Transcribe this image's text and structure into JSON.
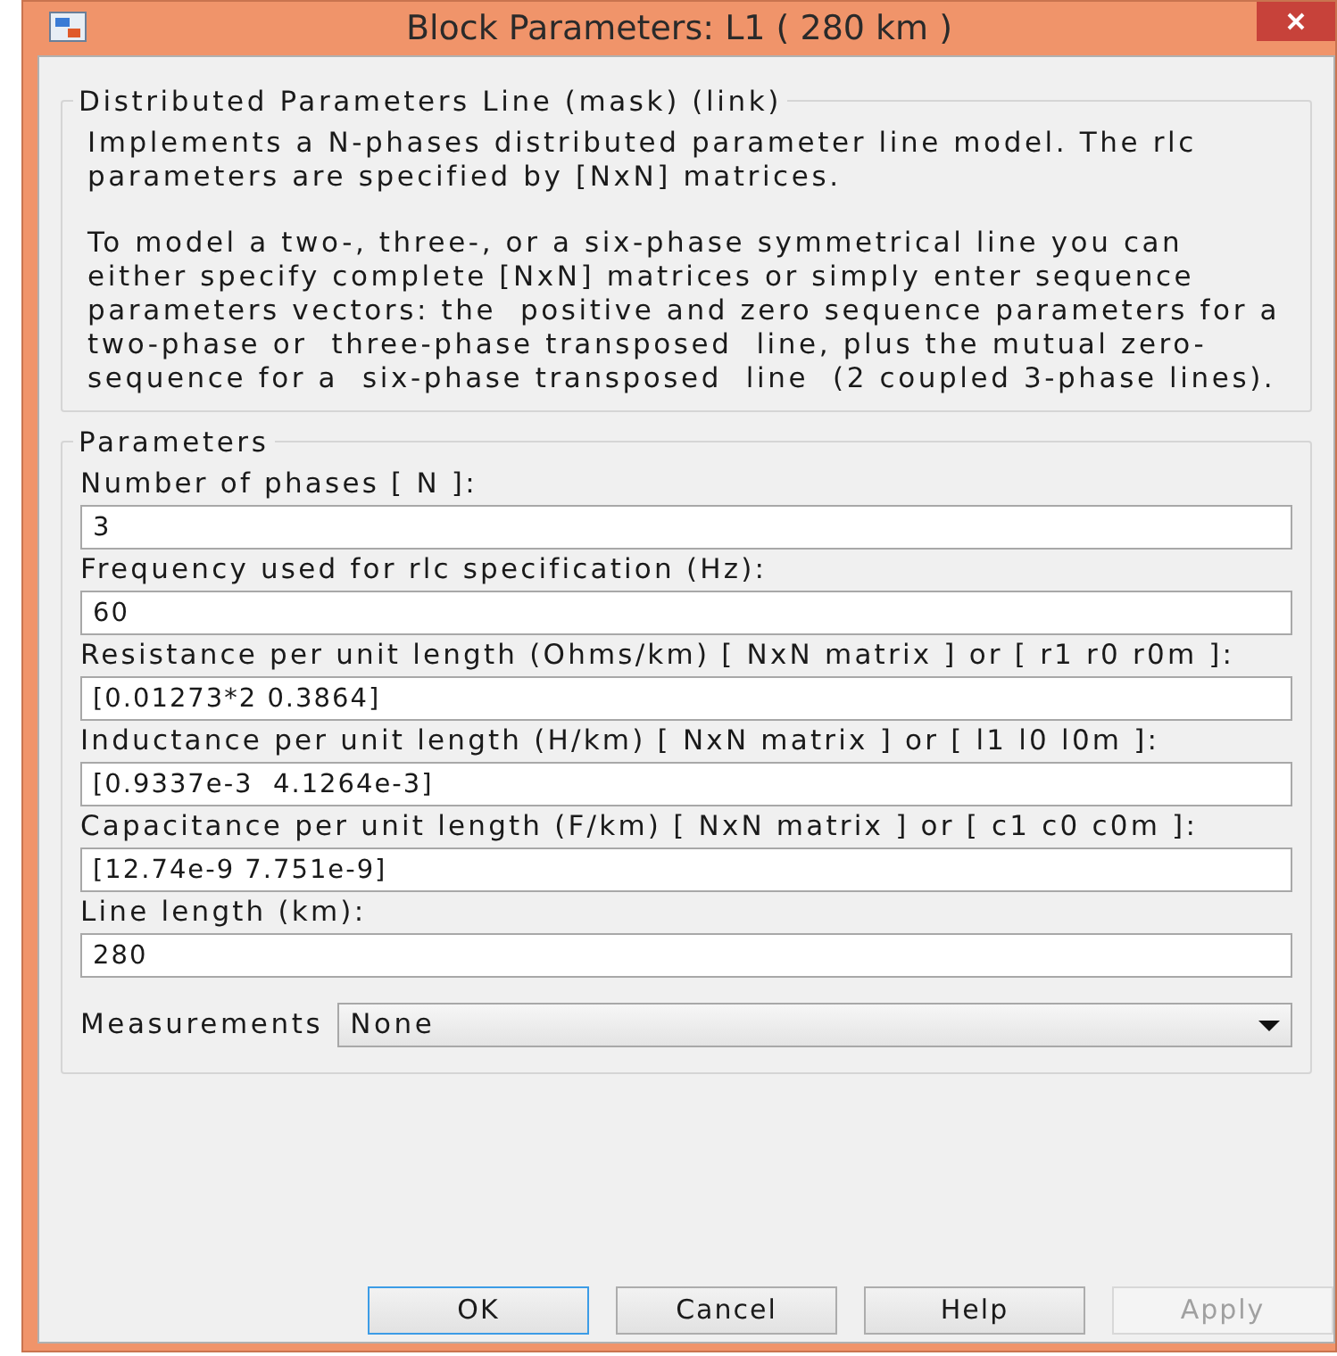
{
  "window": {
    "title": "Block Parameters: L1 ( 280 km )"
  },
  "description": {
    "title": "Distributed Parameters Line (mask) (link)",
    "paragraphs": [
      "Implements a N-phases distributed parameter line model. The rlc\nparameters are specified by [NxN] matrices.",
      "To model a two-, three-, or a six-phase symmetrical line you can\neither specify complete [NxN] matrices or simply enter sequence\nparameters vectors: the  positive and zero sequence parameters for a\ntwo-phase or  three-phase transposed  line, plus the mutual zero-\nsequence for a  six-phase transposed  line  (2 coupled 3-phase lines)."
    ]
  },
  "parameters": {
    "title": "Parameters",
    "fields": [
      {
        "label": "Number of phases [ N ]:",
        "value": "3"
      },
      {
        "label": "Frequency used for rlc specification (Hz):",
        "value": "60"
      },
      {
        "label": "Resistance per unit length (Ohms/km) [ NxN matrix ] or [ r1 r0 r0m ]:",
        "value": "[0.01273*2 0.3864]"
      },
      {
        "label": "Inductance per unit length (H/km) [ NxN matrix ] or [ l1 l0 l0m ]:",
        "value": "[0.9337e-3  4.1264e-3]"
      },
      {
        "label": "Capacitance per unit length (F/km) [ NxN matrix ] or [ c1 c0 c0m ]:",
        "value": "[12.74e-9 7.751e-9]"
      },
      {
        "label": "Line length (km):",
        "value": "280"
      }
    ],
    "measurements": {
      "label": "Measurements",
      "value": "None"
    }
  },
  "buttons": [
    {
      "label": "OK",
      "default": true,
      "disabled": false
    },
    {
      "label": "Cancel",
      "default": false,
      "disabled": false
    },
    {
      "label": "Help",
      "default": false,
      "disabled": false
    },
    {
      "label": "Apply",
      "default": false,
      "disabled": true
    }
  ]
}
